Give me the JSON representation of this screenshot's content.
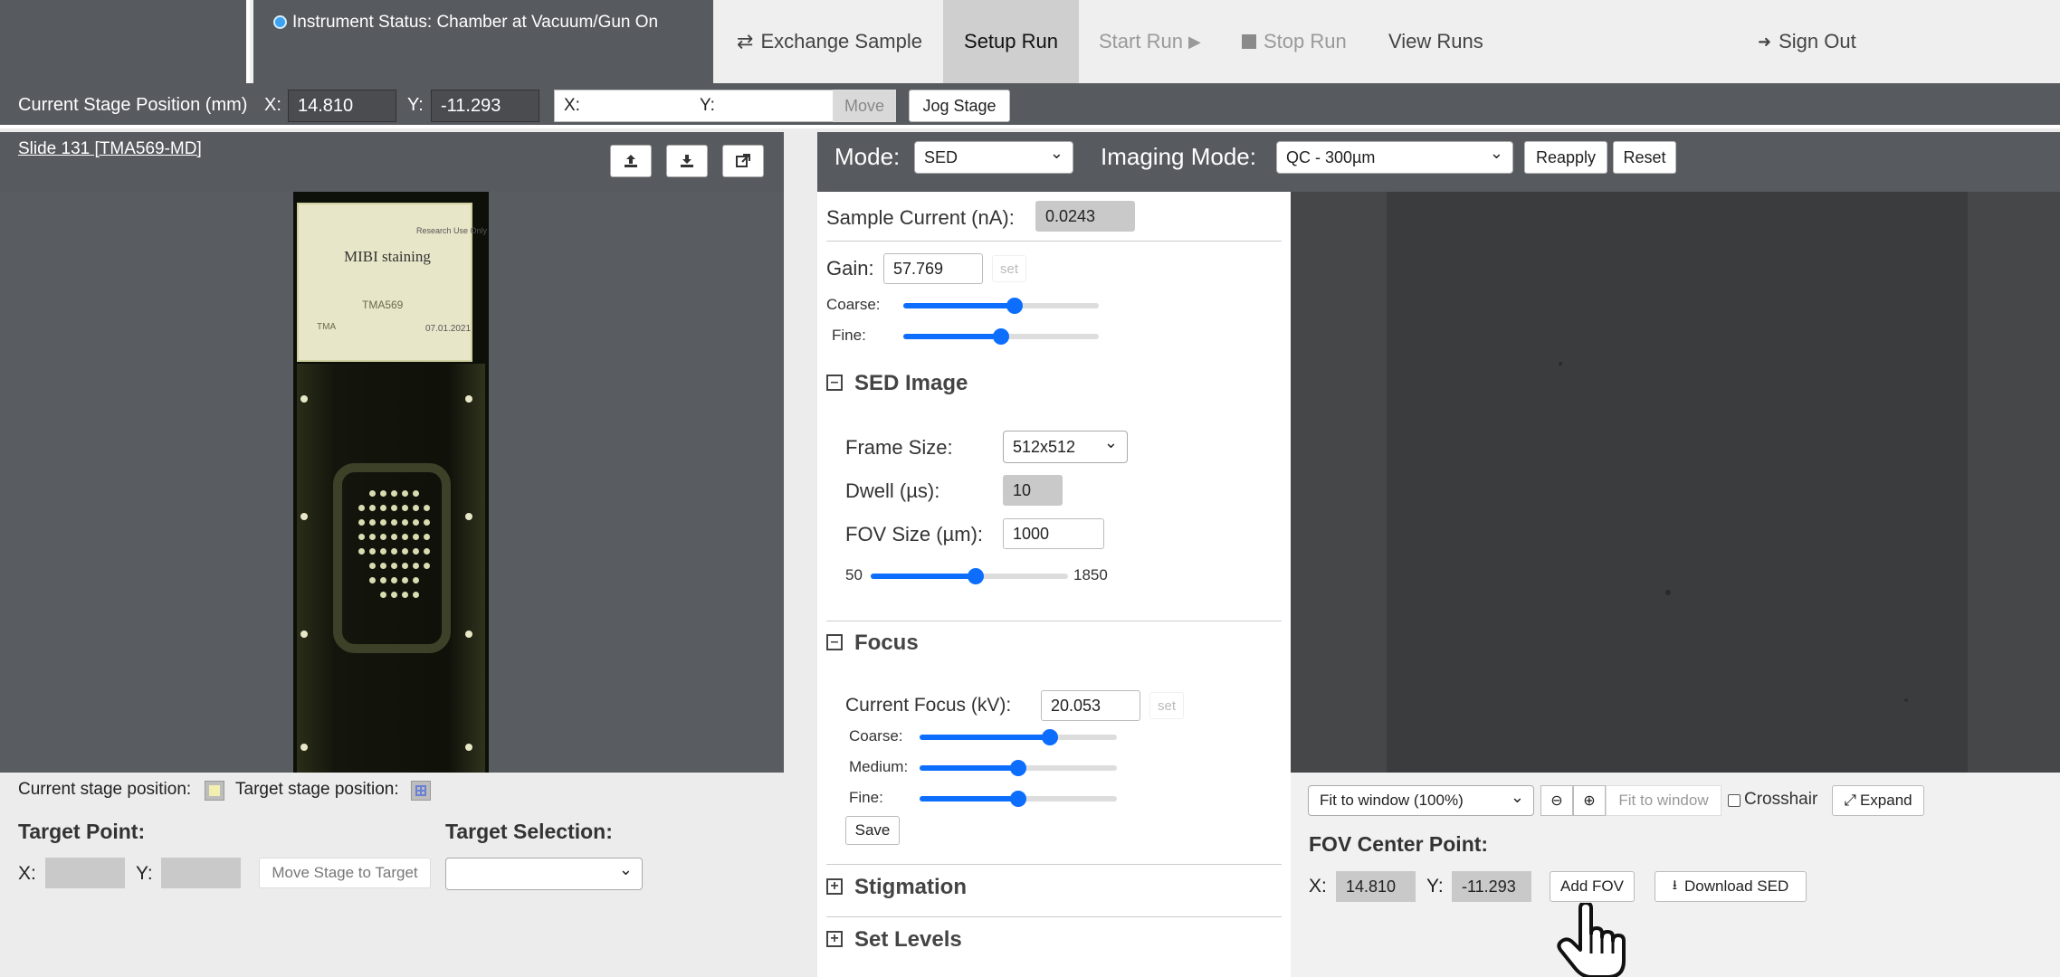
{
  "header": {
    "instrument_status": "Instrument Status: Chamber at Vacuum/Gun On",
    "nav": {
      "exchange_sample": "Exchange Sample",
      "setup_run": "Setup Run",
      "start_run": "Start Run",
      "stop_run": "Stop Run",
      "view_runs": "View Runs",
      "sign_out": "Sign Out"
    }
  },
  "stage_bar": {
    "label": "Current Stage Position (mm)",
    "x_label": "X:",
    "x_value": "14.810",
    "y_label": "Y:",
    "y_value": "-11.293",
    "target_x_label": "X:",
    "target_y_label": "Y:",
    "move_button": "Move",
    "jog_button": "Jog Stage"
  },
  "slide": {
    "title": "Slide 131 [TMA569-MD]",
    "label_lines": [
      "Research Use Only",
      "MIBI staining",
      "TMA569",
      "TMA",
      "07.01.2021"
    ]
  },
  "left_bottom": {
    "current_stage_label": "Current stage position:",
    "target_stage_label": "Target stage position:",
    "target_point_heading": "Target Point:",
    "x_label": "X:",
    "y_label": "Y:",
    "move_stage_button": "Move Stage to Target",
    "target_selection_heading": "Target Selection:",
    "target_selection_value": ""
  },
  "mode_bar": {
    "mode_label": "Mode:",
    "mode_value": "SED",
    "imaging_mode_label": "Imaging Mode:",
    "imaging_mode_value": "QC - 300µm",
    "reapply": "Reapply",
    "reset": "Reset"
  },
  "controls": {
    "sample_current_label": "Sample Current (nA):",
    "sample_current_value": "0.0243",
    "gain_label": "Gain:",
    "gain_value": "57.769",
    "gain_set": "set",
    "coarse_label": "Coarse:",
    "fine_label": "Fine:",
    "gain_coarse": 0.57,
    "gain_fine": 0.5,
    "sed_image_heading": "SED Image",
    "frame_size_label": "Frame Size:",
    "frame_size_value": "512x512",
    "dwell_label": "Dwell (µs):",
    "dwell_value": "10",
    "fov_size_label": "FOV Size (µm):",
    "fov_size_value": "1000",
    "fov_min": "50",
    "fov_max": "1850",
    "fov_slider": 0.53,
    "focus_heading": "Focus",
    "current_focus_label": "Current Focus (kV):",
    "current_focus_value": "20.053",
    "focus_set": "set",
    "focus_coarse_label": "Coarse:",
    "focus_medium_label": "Medium:",
    "focus_fine_label": "Fine:",
    "focus_coarse": 0.66,
    "focus_medium": 0.5,
    "focus_fine": 0.5,
    "save": "Save",
    "stigmation_heading": "Stigmation",
    "set_levels_heading": "Set Levels"
  },
  "image_tools": {
    "zoom_select": "Fit to window (100%)",
    "fit_to_window": "Fit to window",
    "crosshair": "Crosshair",
    "expand": "Expand",
    "fov_center_heading": "FOV Center Point:",
    "x_label": "X:",
    "x_value": "14.810",
    "y_label": "Y:",
    "y_value": "-11.293",
    "add_fov": "Add FOV",
    "download_sed": "Download SED"
  }
}
